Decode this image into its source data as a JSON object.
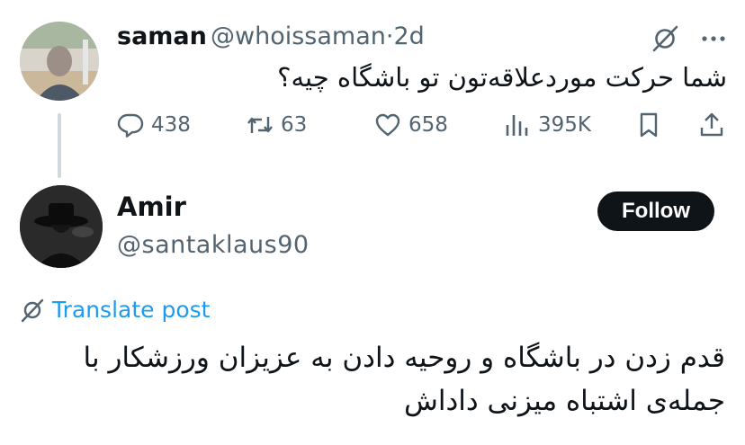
{
  "parent_post": {
    "author_name": "saman",
    "author_handle": "@whoissaman",
    "separator": "·",
    "age": "2d",
    "text": "شما حرکت موردعلاقه‌تون تو باشگاه چیه؟",
    "stats": {
      "replies": "438",
      "reposts": "63",
      "likes": "658",
      "views": "395K"
    }
  },
  "reply_post": {
    "author_name": "Amir",
    "author_handle": "@santaklaus90",
    "follow_label": "Follow",
    "translate_label": "Translate post",
    "text": "قدم زدن در باشگاه و روحیه دادن به عزیزان ورزشکار با جمله‌ی اشتباه میزنی داداش"
  },
  "icons": {
    "grok": "grok-icon",
    "more": "more-icon",
    "reply": "reply-icon",
    "repost": "repost-icon",
    "like": "heart-icon",
    "views": "views-icon",
    "bookmark": "bookmark-icon",
    "share": "share-icon",
    "translate": "translate-icon"
  },
  "colors": {
    "text": "#0f1419",
    "secondary": "#536471",
    "link": "#1d9bf0",
    "button": "#0f1419"
  }
}
